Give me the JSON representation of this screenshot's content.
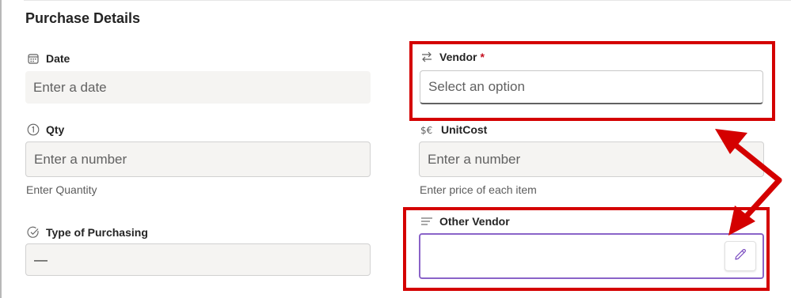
{
  "section": {
    "title": "Purchase Details"
  },
  "fields": {
    "date": {
      "label": "Date",
      "placeholder": "Enter a date",
      "icon": "calendar-icon"
    },
    "vendor": {
      "label": "Vendor",
      "required_mark": "*",
      "placeholder": "Select an option",
      "icon": "swap-arrows-icon"
    },
    "qty": {
      "label": "Qty",
      "placeholder": "Enter a number",
      "hint": "Enter Quantity",
      "icon": "number-one-circle-icon"
    },
    "unit_cost": {
      "label": "UnitCost",
      "placeholder": "Enter a number",
      "hint": "Enter price of each item",
      "icon": "currency-icon"
    },
    "type_of_purchasing": {
      "label": "Type of Purchasing",
      "value": "—",
      "icon": "check-circle-icon"
    },
    "other_vendor": {
      "label": "Other Vendor",
      "value": "",
      "icon": "text-lines-icon"
    }
  },
  "colors": {
    "highlight": "#d40000",
    "focus_border": "#8a63c8",
    "input_bg": "#f5f4f2",
    "required": "#c50f1f"
  }
}
